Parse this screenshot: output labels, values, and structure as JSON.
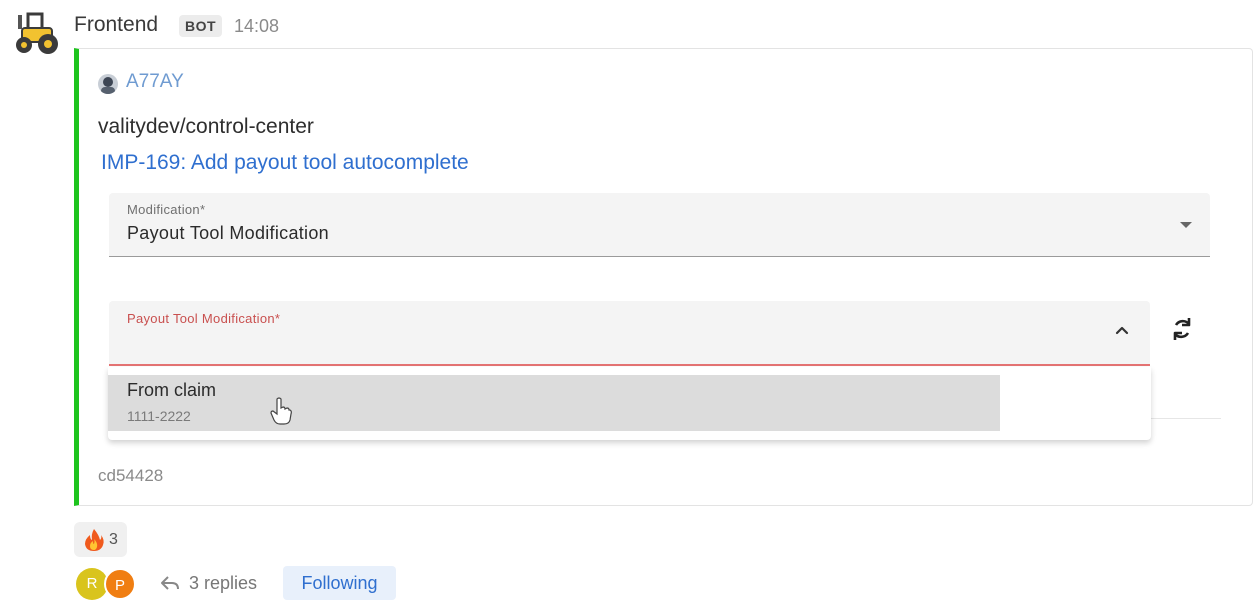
{
  "message": {
    "sender": "Frontend",
    "badge": "BOT",
    "time": "14:08",
    "bot_avatar_icon": "tractor-icon"
  },
  "card": {
    "author": "A77AY",
    "repo": "valitydev/control-center",
    "pr_title": "IMP-169: Add payout tool autocomplete",
    "accent_color": "#1ec41e",
    "form": {
      "modification_label": "Modification*",
      "modification_value": "Payout Tool Modification",
      "payout_label": "Payout Tool Modification*",
      "payout_value": "",
      "options": [
        {
          "title": "From claim",
          "subtitle": "1111-2222"
        }
      ]
    },
    "commit": "cd54428"
  },
  "reaction": {
    "emoji": "fire-icon",
    "count": "3"
  },
  "thread": {
    "participants": [
      "R",
      "P"
    ],
    "participant_colors": [
      "#d9c41d",
      "#f07e12"
    ],
    "replies": "3 replies",
    "following": "Following"
  }
}
